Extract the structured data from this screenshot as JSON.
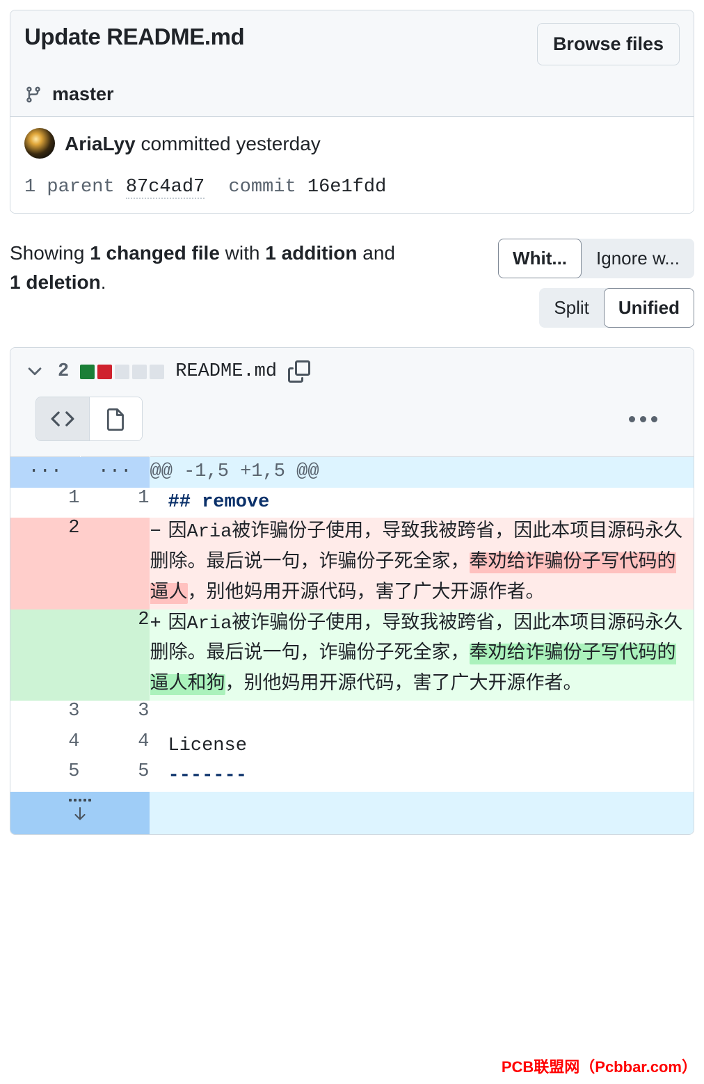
{
  "commit": {
    "title": "Update README.md",
    "browse_files_label": "Browse files",
    "branch_icon": "git-branch-icon",
    "branch_name": "master",
    "author": "AriaLyy",
    "author_action": "committed yesterday",
    "parents_label": "1 parent",
    "parent_hash": "87c4ad7",
    "commit_label": "commit",
    "commit_hash": "16e1fdd"
  },
  "summary": {
    "prefix": "Showing ",
    "changed_files": "1 changed file",
    "mid": " with ",
    "additions": "1 addition",
    "conj": " and ",
    "deletions": "1 deletion",
    "suffix": "."
  },
  "controls": {
    "whitespace_label": "Whit...",
    "ignore_whitespace_label": "Ignore w...",
    "split_label": "Split",
    "unified_label": "Unified",
    "whitespace_selected": true,
    "unified_selected": true
  },
  "file": {
    "change_count": "2",
    "name": "README.md",
    "chevron_icon": "chevron-down-icon",
    "copy_icon": "copy-icon",
    "diffstat": [
      "add",
      "del",
      "neutral",
      "neutral",
      "neutral"
    ],
    "code_view_icon": "code-brackets-icon",
    "rich_view_icon": "file-document-icon",
    "kebab_icon": "kebab-menu-icon",
    "expand_icon": "expand-down-icon"
  },
  "diff": {
    "hunk_header": "@@ -1,5 +1,5 @@",
    "hunk_marker": "...",
    "rows": [
      {
        "type": "ctx",
        "old": "1",
        "new": "1",
        "sign": " ",
        "text": "## remove",
        "style": "md-head"
      },
      {
        "type": "del",
        "old": "2",
        "new": "",
        "sign": "−",
        "pre": "因Aria被诈骗份子使用，导致我被跨省，因此本项目源码永久删除。最后说一句，诈骗份子死全家，",
        "hl": "奉劝给诈骗份子写代码的逼人",
        "post": "，别他妈用开源代码，害了广大开源作者。"
      },
      {
        "type": "add",
        "old": "",
        "new": "2",
        "sign": "+",
        "pre": "因Aria被诈骗份子使用，导致我被跨省，因此本项目源码永久删除。最后说一句，诈骗份子死全家，",
        "hl": "奉劝给诈骗份子写代码的逼人和狗",
        "post": "，别他妈用开源代码，害了广大开源作者。"
      },
      {
        "type": "ctx",
        "old": "3",
        "new": "3",
        "sign": " ",
        "text": "",
        "style": ""
      },
      {
        "type": "ctx",
        "old": "4",
        "new": "4",
        "sign": " ",
        "text": "License",
        "style": ""
      },
      {
        "type": "ctx",
        "old": "5",
        "new": "5",
        "sign": " ",
        "text": "-------",
        "style": "md-rule"
      }
    ]
  },
  "watermark": "PCB联盟网（Pcbbar.com）"
}
